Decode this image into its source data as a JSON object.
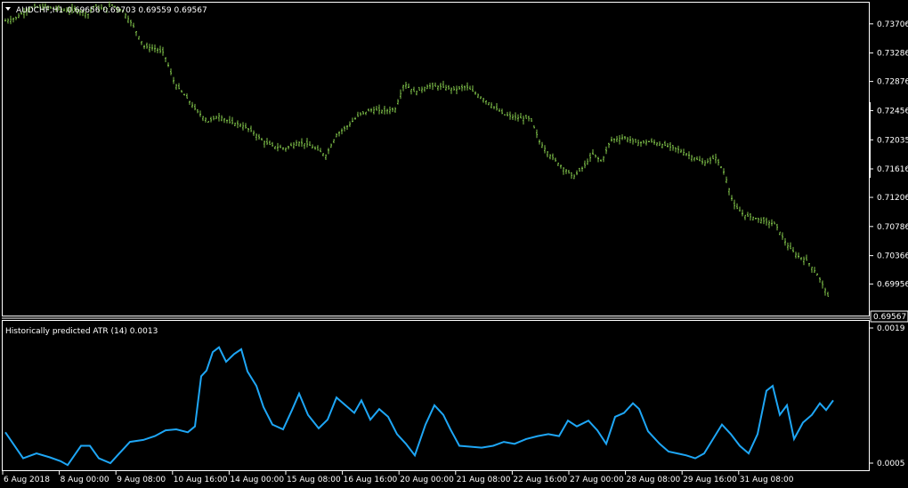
{
  "main_pane": {
    "title_prefix": "AUDCHF,H1",
    "ohlc": "0.69656 0.69703 0.69559 0.69567",
    "current_price_label": "0.69567",
    "price_ticks": [
      "0.73706",
      "0.73286",
      "0.72876",
      "0.72456",
      "0.72035",
      "0.71616",
      "0.71206",
      "0.70786",
      "0.70366",
      "0.69956"
    ]
  },
  "indicator_pane": {
    "title": "Historically predicted ATR (14) 0.0013",
    "ticks": [
      "0.0019",
      "0.0005"
    ]
  },
  "time_axis": [
    "6 Aug 2018",
    "8 Aug 00:00",
    "9 Aug 08:00",
    "10 Aug 16:00",
    "14 Aug 00:00",
    "15 Aug 08:00",
    "16 Aug 16:00",
    "20 Aug 00:00",
    "21 Aug 08:00",
    "22 Aug 16:00",
    "27 Aug 00:00",
    "28 Aug 08:00",
    "29 Aug 16:00",
    "31 Aug 08:00"
  ],
  "colors": {
    "candles": "#7FC24A",
    "atr_line": "#1EA6F5",
    "grid_frame": "#FFFFFF",
    "background": "#000000"
  },
  "chart_data": [
    {
      "type": "line",
      "series": [
        {
          "y_key_points": [
            [
              0,
              0.7375
            ],
            [
              12,
              0.7379
            ],
            [
              25,
              0.7392
            ],
            [
              40,
              0.7395
            ],
            [
              56,
              0.7393
            ],
            [
              68,
              0.739
            ],
            [
              80,
              0.7391
            ],
            [
              94,
              0.7384
            ],
            [
              98,
              0.7396
            ],
            [
              112,
              0.7391
            ],
            [
              120,
              0.7398
            ],
            [
              132,
              0.7389
            ],
            [
              143,
              0.7369
            ],
            [
              156,
              0.7338
            ],
            [
              168,
              0.7335
            ],
            [
              178,
              0.7329
            ],
            [
              190,
              0.7285
            ],
            [
              205,
              0.7262
            ],
            [
              215,
              0.7245
            ],
            [
              228,
              0.723
            ],
            [
              240,
              0.7238
            ],
            [
              252,
              0.7229
            ],
            [
              265,
              0.7225
            ],
            [
              278,
              0.7215
            ],
            [
              290,
              0.7201
            ],
            [
              302,
              0.7194
            ],
            [
              315,
              0.7191
            ],
            [
              328,
              0.72
            ],
            [
              340,
              0.7197
            ],
            [
              352,
              0.7188
            ],
            [
              360,
              0.7181
            ],
            [
              372,
              0.7211
            ],
            [
              385,
              0.7224
            ],
            [
              398,
              0.724
            ],
            [
              412,
              0.7247
            ],
            [
              425,
              0.7245
            ],
            [
              438,
              0.7248
            ],
            [
              448,
              0.7285
            ],
            [
              460,
              0.7272
            ],
            [
              475,
              0.7281
            ],
            [
              490,
              0.728
            ],
            [
              505,
              0.7276
            ],
            [
              518,
              0.728
            ],
            [
              530,
              0.7269
            ],
            [
              545,
              0.7255
            ],
            [
              560,
              0.724
            ],
            [
              575,
              0.7235
            ],
            [
              590,
              0.7234
            ],
            [
              600,
              0.7201
            ],
            [
              612,
              0.7181
            ],
            [
              625,
              0.7165
            ],
            [
              638,
              0.715
            ],
            [
              650,
              0.7165
            ],
            [
              660,
              0.7183
            ],
            [
              670,
              0.7172
            ],
            [
              680,
              0.7203
            ],
            [
              695,
              0.7207
            ],
            [
              710,
              0.7199
            ],
            [
              725,
              0.7201
            ],
            [
              740,
              0.7196
            ],
            [
              755,
              0.719
            ],
            [
              770,
              0.718
            ],
            [
              785,
              0.717
            ],
            [
              798,
              0.7178
            ],
            [
              808,
              0.7155
            ],
            [
              818,
              0.711
            ],
            [
              830,
              0.7095
            ],
            [
              842,
              0.7091
            ],
            [
              855,
              0.7085
            ],
            [
              865,
              0.7082
            ],
            [
              878,
              0.7052
            ],
            [
              890,
              0.7036
            ],
            [
              900,
              0.703
            ],
            [
              912,
              0.701
            ],
            [
              922,
              0.6985
            ],
            [
              930,
              0.6957
            ]
          ]
        }
      ]
    },
    {
      "type": "line",
      "series": [
        {
          "y_key_points": [
            [
              0,
              0.00082
            ],
            [
              20,
              0.00055
            ],
            [
              35,
              0.0006
            ],
            [
              50,
              0.00056
            ],
            [
              62,
              0.00052
            ],
            [
              70,
              0.00048
            ],
            [
              85,
              0.00068
            ],
            [
              95,
              0.00068
            ],
            [
              105,
              0.00055
            ],
            [
              118,
              0.0005
            ],
            [
              128,
              0.0006
            ],
            [
              140,
              0.00072
            ],
            [
              155,
              0.00074
            ],
            [
              168,
              0.00078
            ],
            [
              180,
              0.00084
            ],
            [
              192,
              0.00085
            ],
            [
              205,
              0.00082
            ],
            [
              213,
              0.00088
            ],
            [
              220,
              0.0014
            ],
            [
              226,
              0.00146
            ],
            [
              233,
              0.00165
            ],
            [
              240,
              0.0017
            ],
            [
              248,
              0.00155
            ],
            [
              257,
              0.00163
            ],
            [
              265,
              0.00168
            ],
            [
              272,
              0.00145
            ],
            [
              282,
              0.0013
            ],
            [
              290,
              0.00108
            ],
            [
              300,
              0.0009
            ],
            [
              312,
              0.00085
            ],
            [
              322,
              0.00105
            ],
            [
              330,
              0.00122
            ],
            [
              340,
              0.001
            ],
            [
              352,
              0.00086
            ],
            [
              362,
              0.00095
            ],
            [
              372,
              0.00118
            ],
            [
              382,
              0.0011
            ],
            [
              392,
              0.00102
            ],
            [
              400,
              0.00115
            ],
            [
              410,
              0.00095
            ],
            [
              420,
              0.00106
            ],
            [
              430,
              0.00098
            ],
            [
              440,
              0.0008
            ],
            [
              450,
              0.0007
            ],
            [
              460,
              0.00058
            ],
            [
              472,
              0.0009
            ],
            [
              482,
              0.0011
            ],
            [
              492,
              0.001
            ],
            [
              500,
              0.00085
            ],
            [
              510,
              0.00068
            ],
            [
              522,
              0.00067
            ],
            [
              535,
              0.00066
            ],
            [
              548,
              0.00068
            ],
            [
              560,
              0.00072
            ],
            [
              572,
              0.0007
            ],
            [
              585,
              0.00075
            ],
            [
              598,
              0.00078
            ],
            [
              610,
              0.0008
            ],
            [
              622,
              0.00078
            ],
            [
              632,
              0.00094
            ],
            [
              642,
              0.00088
            ],
            [
              655,
              0.00094
            ],
            [
              665,
              0.00084
            ],
            [
              675,
              0.0007
            ],
            [
              685,
              0.00098
            ],
            [
              695,
              0.00102
            ],
            [
              705,
              0.00112
            ],
            [
              712,
              0.00106
            ],
            [
              722,
              0.00083
            ],
            [
              735,
              0.0007
            ],
            [
              745,
              0.00062
            ],
            [
              755,
              0.0006
            ],
            [
              765,
              0.00058
            ],
            [
              775,
              0.00055
            ],
            [
              785,
              0.0006
            ],
            [
              795,
              0.00075
            ],
            [
              805,
              0.0009
            ],
            [
              815,
              0.0008
            ],
            [
              825,
              0.00068
            ],
            [
              835,
              0.0006
            ],
            [
              845,
              0.0008
            ],
            [
              855,
              0.00125
            ],
            [
              862,
              0.0013
            ],
            [
              870,
              0.001
            ],
            [
              878,
              0.0011
            ],
            [
              886,
              0.00075
            ],
            [
              896,
              0.00092
            ],
            [
              906,
              0.001
            ],
            [
              915,
              0.00112
            ],
            [
              922,
              0.00105
            ],
            [
              930,
              0.00115
            ]
          ]
        }
      ]
    }
  ]
}
